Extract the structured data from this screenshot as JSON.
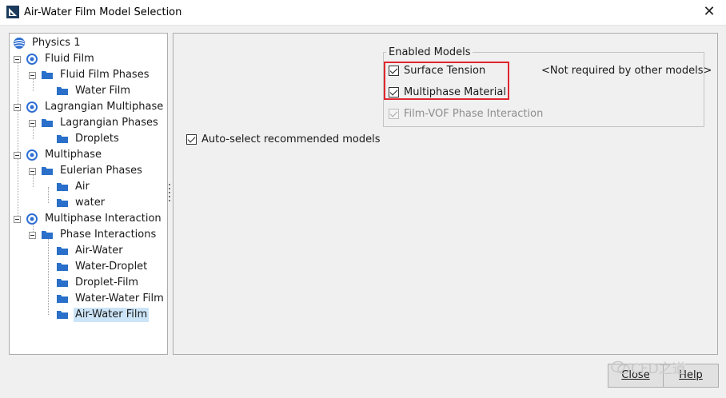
{
  "window": {
    "title": "Air-Water Film Model Selection",
    "close_glyph": "✕"
  },
  "tree": [
    {
      "label": "Physics 1",
      "icon": "globe-icon"
    },
    {
      "label": "Fluid Film",
      "icon": "model-icon"
    },
    {
      "label": "Fluid Film Phases",
      "icon": "folder-icon"
    },
    {
      "label": "Water Film",
      "icon": "folder-icon"
    },
    {
      "label": "Lagrangian Multiphase",
      "icon": "model-icon"
    },
    {
      "label": "Lagrangian Phases",
      "icon": "folder-icon"
    },
    {
      "label": "Droplets",
      "icon": "folder-icon"
    },
    {
      "label": "Multiphase",
      "icon": "model-icon"
    },
    {
      "label": "Eulerian Phases",
      "icon": "folder-icon"
    },
    {
      "label": "Air",
      "icon": "folder-icon"
    },
    {
      "label": "water",
      "icon": "folder-icon"
    },
    {
      "label": "Multiphase Interaction",
      "icon": "model-icon"
    },
    {
      "label": "Phase Interactions",
      "icon": "folder-icon"
    },
    {
      "label": "Air-Water",
      "icon": "folder-icon"
    },
    {
      "label": "Water-Droplet",
      "icon": "folder-icon"
    },
    {
      "label": "Droplet-Film",
      "icon": "folder-icon"
    },
    {
      "label": "Water-Water Film",
      "icon": "folder-icon"
    },
    {
      "label": "Air-Water Film",
      "icon": "folder-icon",
      "selected": true
    }
  ],
  "enabled_models": {
    "legend": "Enabled Models",
    "items": [
      {
        "label": "Surface Tension",
        "checked": true,
        "disabled": false
      },
      {
        "label": "Multiphase Material",
        "checked": true,
        "disabled": false
      },
      {
        "label": "Film-VOF Phase Interaction",
        "checked": true,
        "disabled": true
      }
    ],
    "note": "<Not required by other models>"
  },
  "auto_select": {
    "label": "Auto-select recommended models",
    "checked": true
  },
  "buttons": {
    "close": "Close",
    "help": "Help"
  },
  "watermark": "CFD之道",
  "colors": {
    "highlight": "#e0262e",
    "selection": "#cce4f7",
    "folder": "#2a6fc9"
  }
}
